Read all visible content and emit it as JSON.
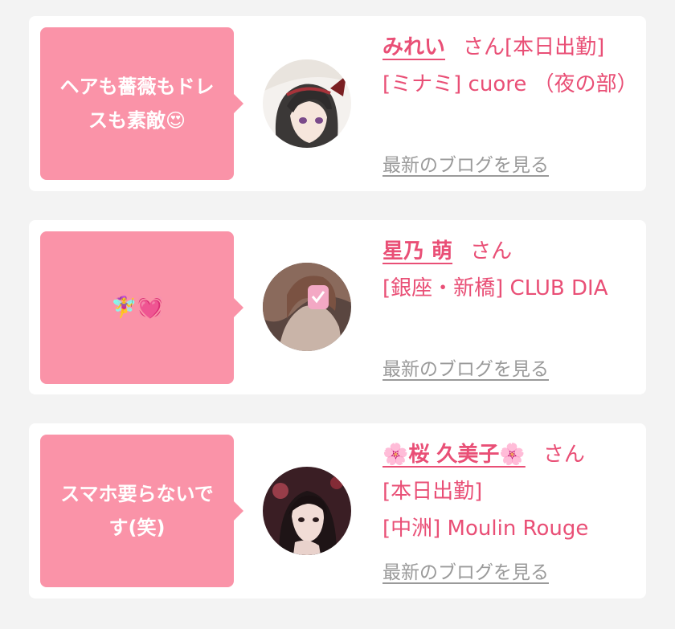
{
  "cards": [
    {
      "message": "ヘアも薔薇もドレスも素敵😍",
      "name": "みれい",
      "honorific": "さん",
      "status": "[本日出勤]",
      "shop": "[ミナミ] cuore （夜の部）",
      "blog_link": "最新のブログを見る",
      "avatar_icon": "anime-girl-avatar-icon"
    },
    {
      "message": "🧚‍♀️💓",
      "name": "星乃 萌",
      "honorific": "さん",
      "status": "",
      "shop": "[銀座・新橋] CLUB DIA",
      "blog_link": "最新のブログを見る",
      "avatar_icon": "woman-photo-avatar-icon"
    },
    {
      "message": "スマホ要らないです(笑)",
      "name": "🌸桜 久美子🌸",
      "honorific": "さん",
      "status": "[本日出勤]",
      "shop": "[中洲] Moulin Rouge",
      "blog_link": "最新のブログを見る",
      "avatar_icon": "woman-portrait-avatar-icon"
    }
  ],
  "colors": {
    "accent": "#e94f76",
    "bubble": "#fa93a8",
    "link_gray": "#9a9a9a",
    "background": "#f3f3f3"
  }
}
